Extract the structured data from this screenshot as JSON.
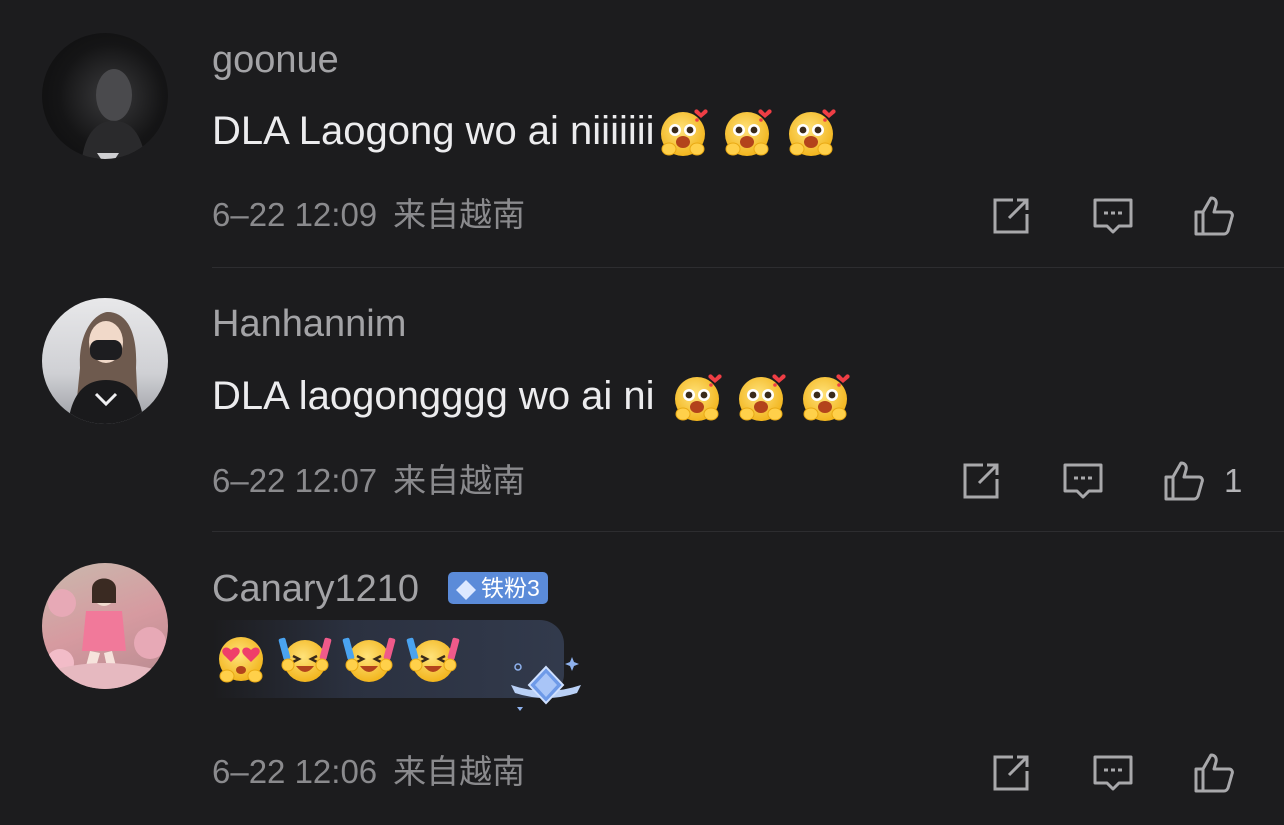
{
  "comments": [
    {
      "username": "goonue",
      "text": "DLA Laogong wo ai niiiiiii",
      "emojis": [
        "heart-eyes-blush-emoji",
        "heart-eyes-blush-emoji",
        "heart-eyes-blush-emoji"
      ],
      "time": "6–22 12:09",
      "location": "来自越南",
      "likes": ""
    },
    {
      "username": "Hanhannim",
      "text": "DLA laogongggg wo ai ni",
      "emojis": [
        "heart-eyes-blush-emoji",
        "heart-eyes-blush-emoji",
        "heart-eyes-blush-emoji"
      ],
      "time": "6–22 12:07",
      "location": "来自越南",
      "likes": "1"
    },
    {
      "username": "Canary1210",
      "badge": "铁粉3",
      "emojis": [
        "heart-eyes-emoji",
        "cheering-emoji",
        "cheering-emoji",
        "cheering-emoji"
      ],
      "time": "6–22 12:06",
      "location": "来自越南",
      "likes": ""
    }
  ],
  "icons": {
    "share": "share-icon",
    "comment": "comment-icon",
    "like": "thumbs-up-icon"
  },
  "colors": {
    "background": "#1c1c1e",
    "badge": "#5b8bd9",
    "emoji_yellow": "#f7c440"
  }
}
